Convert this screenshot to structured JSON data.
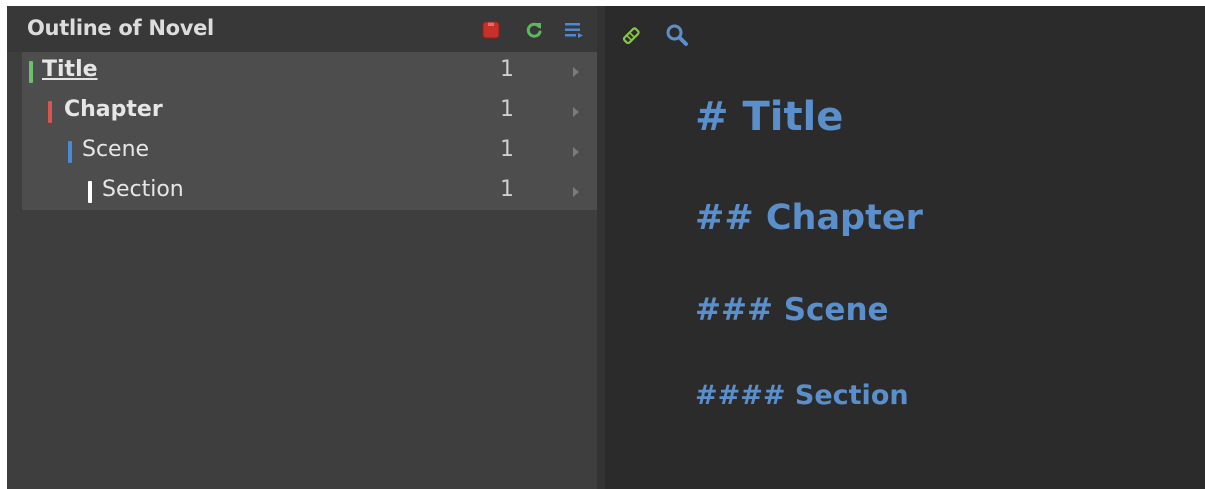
{
  "outline": {
    "title": "Outline of Novel",
    "toolbar": {
      "stop_icon": "stop-icon",
      "refresh_icon": "refresh-icon",
      "menu_icon": "menu-lines-icon"
    },
    "items": [
      {
        "label": "Title",
        "count": "1",
        "level": 1,
        "bar_color": "#6fbf73",
        "bold": true,
        "underline": true
      },
      {
        "label": "Chapter",
        "count": "1",
        "level": 2,
        "bar_color": "#d9534f",
        "bold": true,
        "underline": false
      },
      {
        "label": "Scene",
        "count": "1",
        "level": 3,
        "bar_color": "#4a8ad4",
        "bold": false,
        "underline": false
      },
      {
        "label": "Section",
        "count": "1",
        "level": 4,
        "bar_color": "#ffffff",
        "bold": false,
        "underline": false
      }
    ]
  },
  "editor": {
    "toolbar": {
      "edit_icon": "pencil-icon",
      "search_icon": "search-icon"
    },
    "headings": {
      "h1": "# Title",
      "h2": "## Chapter",
      "h3": "### Scene",
      "h4": "#### Section"
    },
    "heading_color": "#5b8fcb"
  },
  "colors": {
    "background": "#2b2b2b",
    "panel": "#3e3e3e",
    "tree": "#4d4d4d",
    "accent_green": "#6fbf73",
    "accent_red": "#d9534f",
    "accent_blue": "#4a8ad4"
  }
}
